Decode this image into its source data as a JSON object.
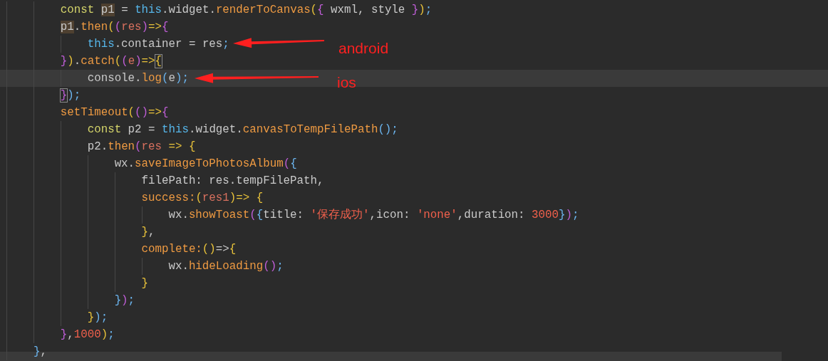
{
  "editor": {
    "lines": [
      {
        "highlighted": false,
        "tokens": [
          {
            "text": "        const ",
            "kind": "kw"
          },
          {
            "text": "p1",
            "kind": "hl"
          },
          {
            "text": " = ",
            "kind": "plain"
          },
          {
            "text": "this",
            "kind": "this"
          },
          {
            "text": ".widget.",
            "kind": "plain"
          },
          {
            "text": "renderToCanvas",
            "kind": "fn"
          },
          {
            "text": "(",
            "kind": "y"
          },
          {
            "text": "{",
            "kind": "m"
          },
          {
            "text": " wxml, style ",
            "kind": "plain"
          },
          {
            "text": "}",
            "kind": "m"
          },
          {
            "text": ")",
            "kind": "y"
          },
          {
            "text": ";",
            "kind": "b"
          }
        ]
      },
      {
        "highlighted": false,
        "tokens": [
          {
            "text": "        p1",
            "kind": "hl"
          },
          {
            "text": ".",
            "kind": "plain"
          },
          {
            "text": "then",
            "kind": "fn"
          },
          {
            "text": "(",
            "kind": "y"
          },
          {
            "text": "(",
            "kind": "m"
          },
          {
            "text": "res",
            "kind": "param"
          },
          {
            "text": ")",
            "kind": "m"
          },
          {
            "text": "=>",
            "kind": "y"
          },
          {
            "text": "{",
            "kind": "m"
          }
        ]
      },
      {
        "highlighted": false,
        "tokens": [
          {
            "text": "            this",
            "kind": "this"
          },
          {
            "text": ".container = res",
            "kind": "plain"
          },
          {
            "text": ";",
            "kind": "b"
          }
        ]
      },
      {
        "highlighted": false,
        "tokens": [
          {
            "text": "        }",
            "kind": "m"
          },
          {
            "text": ")",
            "kind": "y"
          },
          {
            "text": ".",
            "kind": "plain"
          },
          {
            "text": "catch",
            "kind": "fn"
          },
          {
            "text": "(",
            "kind": "y"
          },
          {
            "text": "(",
            "kind": "m"
          },
          {
            "text": "e",
            "kind": "param"
          },
          {
            "text": ")",
            "kind": "m"
          },
          {
            "text": "=>",
            "kind": "y"
          },
          {
            "text": "{",
            "kind": "ymatch"
          }
        ]
      },
      {
        "highlighted": true,
        "tokens": [
          {
            "text": "            console.",
            "kind": "plain"
          },
          {
            "text": "log",
            "kind": "fn"
          },
          {
            "text": "(",
            "kind": "b"
          },
          {
            "text": "e",
            "kind": "plain"
          },
          {
            "text": ")",
            "kind": "b"
          },
          {
            "text": ";",
            "kind": "b"
          }
        ]
      },
      {
        "highlighted": false,
        "tokens": [
          {
            "text": "        }",
            "kind": "mmatch"
          },
          {
            "text": ")",
            "kind": "b"
          },
          {
            "text": ";",
            "kind": "b"
          }
        ]
      },
      {
        "highlighted": false,
        "tokens": [
          {
            "text": "        setTimeout",
            "kind": "fn"
          },
          {
            "text": "(",
            "kind": "y"
          },
          {
            "text": "()",
            "kind": "m"
          },
          {
            "text": "=>",
            "kind": "y"
          },
          {
            "text": "{",
            "kind": "m"
          }
        ]
      },
      {
        "highlighted": false,
        "tokens": [
          {
            "text": "            const",
            "kind": "kw"
          },
          {
            "text": " p2 = ",
            "kind": "plain"
          },
          {
            "text": "this",
            "kind": "this"
          },
          {
            "text": ".widget.",
            "kind": "plain"
          },
          {
            "text": "canvasToTempFilePath",
            "kind": "fn"
          },
          {
            "text": "()",
            "kind": "b"
          },
          {
            "text": ";",
            "kind": "b"
          }
        ]
      },
      {
        "highlighted": false,
        "tokens": [
          {
            "text": "            p2.",
            "kind": "plain"
          },
          {
            "text": "then",
            "kind": "fn"
          },
          {
            "text": "(",
            "kind": "m"
          },
          {
            "text": "res",
            "kind": "param"
          },
          {
            "text": " => ",
            "kind": "y"
          },
          {
            "text": "{",
            "kind": "y"
          }
        ]
      },
      {
        "highlighted": false,
        "tokens": [
          {
            "text": "                wx.",
            "kind": "plain"
          },
          {
            "text": "saveImageToPhotosAlbum",
            "kind": "fn"
          },
          {
            "text": "(",
            "kind": "m"
          },
          {
            "text": "{",
            "kind": "b"
          }
        ]
      },
      {
        "highlighted": false,
        "tokens": [
          {
            "text": "                    filePath: res.tempFilePath,",
            "kind": "plain"
          }
        ]
      },
      {
        "highlighted": false,
        "tokens": [
          {
            "text": "                    success:",
            "kind": "fn"
          },
          {
            "text": "(",
            "kind": "y"
          },
          {
            "text": "res1",
            "kind": "param"
          },
          {
            "text": ")",
            "kind": "y"
          },
          {
            "text": "=> {",
            "kind": "y"
          }
        ]
      },
      {
        "highlighted": false,
        "tokens": [
          {
            "text": "                        wx.",
            "kind": "plain"
          },
          {
            "text": "showToast",
            "kind": "fn"
          },
          {
            "text": "(",
            "kind": "m"
          },
          {
            "text": "{",
            "kind": "b"
          },
          {
            "text": "title: ",
            "kind": "plain"
          },
          {
            "text": "'保存成功'",
            "kind": "str"
          },
          {
            "text": ",icon: ",
            "kind": "plain"
          },
          {
            "text": "'none'",
            "kind": "str"
          },
          {
            "text": ",duration: ",
            "kind": "plain"
          },
          {
            "text": "3000",
            "kind": "num"
          },
          {
            "text": "}",
            "kind": "b"
          },
          {
            "text": ")",
            "kind": "m"
          },
          {
            "text": ";",
            "kind": "b"
          }
        ]
      },
      {
        "highlighted": false,
        "tokens": [
          {
            "text": "                    }",
            "kind": "y"
          },
          {
            "text": ",",
            "kind": "plain"
          }
        ]
      },
      {
        "highlighted": false,
        "tokens": [
          {
            "text": "                    complete:",
            "kind": "fn"
          },
          {
            "text": "()",
            "kind": "y"
          },
          {
            "text": "=>",
            "kind": "plain"
          },
          {
            "text": "{",
            "kind": "y"
          }
        ]
      },
      {
        "highlighted": false,
        "tokens": [
          {
            "text": "                        wx.",
            "kind": "plain"
          },
          {
            "text": "hideLoading",
            "kind": "fn"
          },
          {
            "text": "()",
            "kind": "m"
          },
          {
            "text": ";",
            "kind": "b"
          }
        ]
      },
      {
        "highlighted": false,
        "tokens": [
          {
            "text": "                    }",
            "kind": "y"
          }
        ]
      },
      {
        "highlighted": false,
        "tokens": [
          {
            "text": "                }",
            "kind": "b"
          },
          {
            "text": ")",
            "kind": "m"
          },
          {
            "text": ";",
            "kind": "b"
          }
        ]
      },
      {
        "highlighted": false,
        "tokens": [
          {
            "text": "            }",
            "kind": "y"
          },
          {
            "text": ")",
            "kind": "b"
          },
          {
            "text": ";",
            "kind": "b"
          }
        ]
      },
      {
        "highlighted": false,
        "tokens": [
          {
            "text": "        }",
            "kind": "m"
          },
          {
            "text": ",",
            "kind": "plain"
          },
          {
            "text": "1000",
            "kind": "num"
          },
          {
            "text": ")",
            "kind": "y"
          },
          {
            "text": ";",
            "kind": "b"
          }
        ]
      },
      {
        "highlighted": false,
        "tokens": [
          {
            "text": "    }",
            "kind": "b"
          },
          {
            "text": ",",
            "kind": "plain"
          }
        ]
      }
    ]
  },
  "annotations": [
    {
      "text": "android"
    },
    {
      "text": "ios"
    }
  ]
}
